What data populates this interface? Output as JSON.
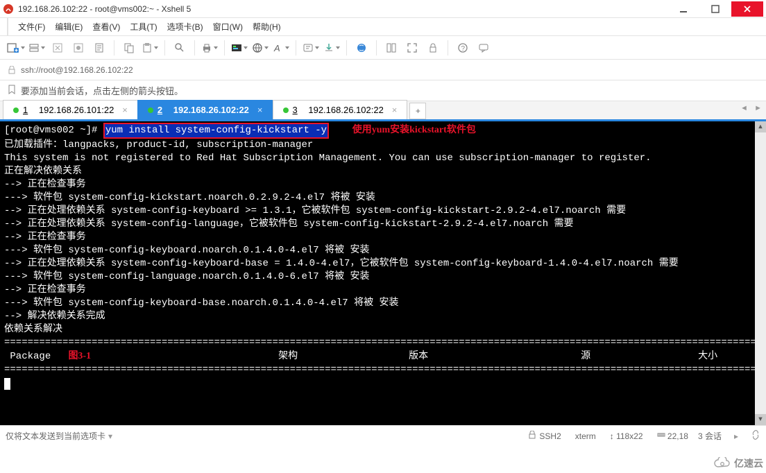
{
  "window": {
    "title": "192.168.26.102:22 - root@vms002:~ - Xshell 5"
  },
  "menu": {
    "file": "文件(F)",
    "edit": "编辑(E)",
    "view": "查看(V)",
    "tools": "工具(T)",
    "tabs": "选项卡(B)",
    "window": "窗口(W)",
    "help": "帮助(H)"
  },
  "addressbar": {
    "url": "ssh://root@192.168.26.102:22"
  },
  "tip": {
    "text": "要添加当前会话，点击左侧的箭头按钮。"
  },
  "tabs": {
    "items": [
      {
        "num": "1",
        "label": "192.168.26.101:22"
      },
      {
        "num": "2",
        "label": "192.168.26.102:22"
      },
      {
        "num": "3",
        "label": "192.168.26.102:22"
      }
    ],
    "add": "+"
  },
  "annotations": {
    "yum_note": "使用yum安装kickstart软件包",
    "figure_label": "图3-1"
  },
  "terminal": {
    "prompt": "[root@vms002 ~]# ",
    "cmd": "yum install system-config-kickstart -y",
    "lines": [
      "已加载插件：langpacks, product-id, subscription-manager",
      "This system is not registered to Red Hat Subscription Management. You can use subscription-manager to register.",
      "正在解决依赖关系",
      "--> 正在检查事务",
      "---> 软件包 system-config-kickstart.noarch.0.2.9.2-4.el7 将被 安装",
      "--> 正在处理依赖关系 system-config-keyboard >= 1.3.1，它被软件包 system-config-kickstart-2.9.2-4.el7.noarch 需要",
      "--> 正在处理依赖关系 system-config-language，它被软件包 system-config-kickstart-2.9.2-4.el7.noarch 需要",
      "--> 正在检查事务",
      "---> 软件包 system-config-keyboard.noarch.0.1.4.0-4.el7 将被 安装",
      "--> 正在处理依赖关系 system-config-keyboard-base = 1.4.0-4.el7，它被软件包 system-config-keyboard-1.4.0-4.el7.noarch 需要",
      "---> 软件包 system-config-language.noarch.0.1.4.0-6.el7 将被 安装",
      "--> 正在检查事务",
      "---> 软件包 system-config-keyboard-base.noarch.0.1.4.0-4.el7 将被 安装",
      "--> 解决依赖关系完成",
      "",
      "依赖关系解决",
      ""
    ],
    "divider": "=====================================================================================================================================",
    "header": {
      "package": "Package",
      "arch": "架构",
      "version": "版本",
      "repo": "源",
      "size": "大小"
    }
  },
  "footer": {
    "send_mode": "仅将文本发送到当前选项卡",
    "ssh": "SSH2",
    "term": "xterm",
    "size": "118x22",
    "pos": "22,18",
    "sessions": "3 会话"
  },
  "watermark": {
    "text": "亿速云"
  }
}
